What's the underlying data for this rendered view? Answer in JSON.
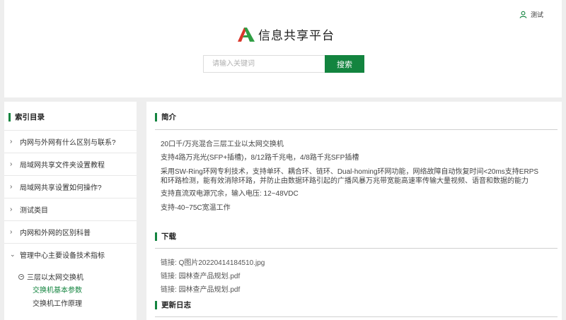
{
  "header": {
    "user_name": "测试",
    "site_title": "信息共享平台",
    "search": {
      "placeholder": "请输入关键词",
      "value": "",
      "button_label": "搜索"
    }
  },
  "sidebar": {
    "title": "索引目录",
    "items": [
      {
        "label": "内网与外网有什么区别与联系?",
        "icon": "chevron-right-icon"
      },
      {
        "label": "局域网共享文件夹设置教程",
        "icon": "chevron-right-icon"
      },
      {
        "label": "局域网共享设置如何操作?",
        "icon": "chevron-right-icon"
      },
      {
        "label": "测试类目",
        "icon": "chevron-right-icon"
      },
      {
        "label": "内网和外网的区别科普",
        "icon": "chevron-right-icon"
      },
      {
        "label": "管理中心主要设备技术指标",
        "icon": "chevron-down-icon"
      }
    ],
    "subgroup": {
      "label": "三层以太网交换机",
      "children": [
        {
          "label": "交换机基本参数",
          "active": true
        },
        {
          "label": "交换机工作原理",
          "active": false
        }
      ]
    }
  },
  "main": {
    "intro": {
      "title": "简介",
      "lines": [
        "20口千/万兆混合三层工业以太网交换机",
        "支持4路万兆光(SFP+插槽)，8/12路千兆电，4/8路千兆SFP插槽",
        "采用SW-Ring环网专利技术，支持单环、耦合环、链环、Dual-homing环网功能，网络故障自动恢复时间<20ms支持ERPS",
        "和环路检测，能有效消除环路，并防止由数据环路引起的广播风暴万兆带宽能高速率传输大量视频、语音和数据的能力",
        "支持直流双电源冗余，输入电压: 12~48VDC",
        "支持-40~75C宽温工作"
      ]
    },
    "download": {
      "title": "下载",
      "prefix": "链接:",
      "files": [
        "Q图片20220414184510.jpg",
        "园林查产品规划.pdf",
        "园林查产品规划.pdf"
      ]
    },
    "changelog": {
      "title": "更新日志"
    }
  },
  "colors": {
    "accent": "#13843f",
    "background": "#eeeeee",
    "logo_red": "#d9362b",
    "logo_green": "#2f9e44"
  }
}
